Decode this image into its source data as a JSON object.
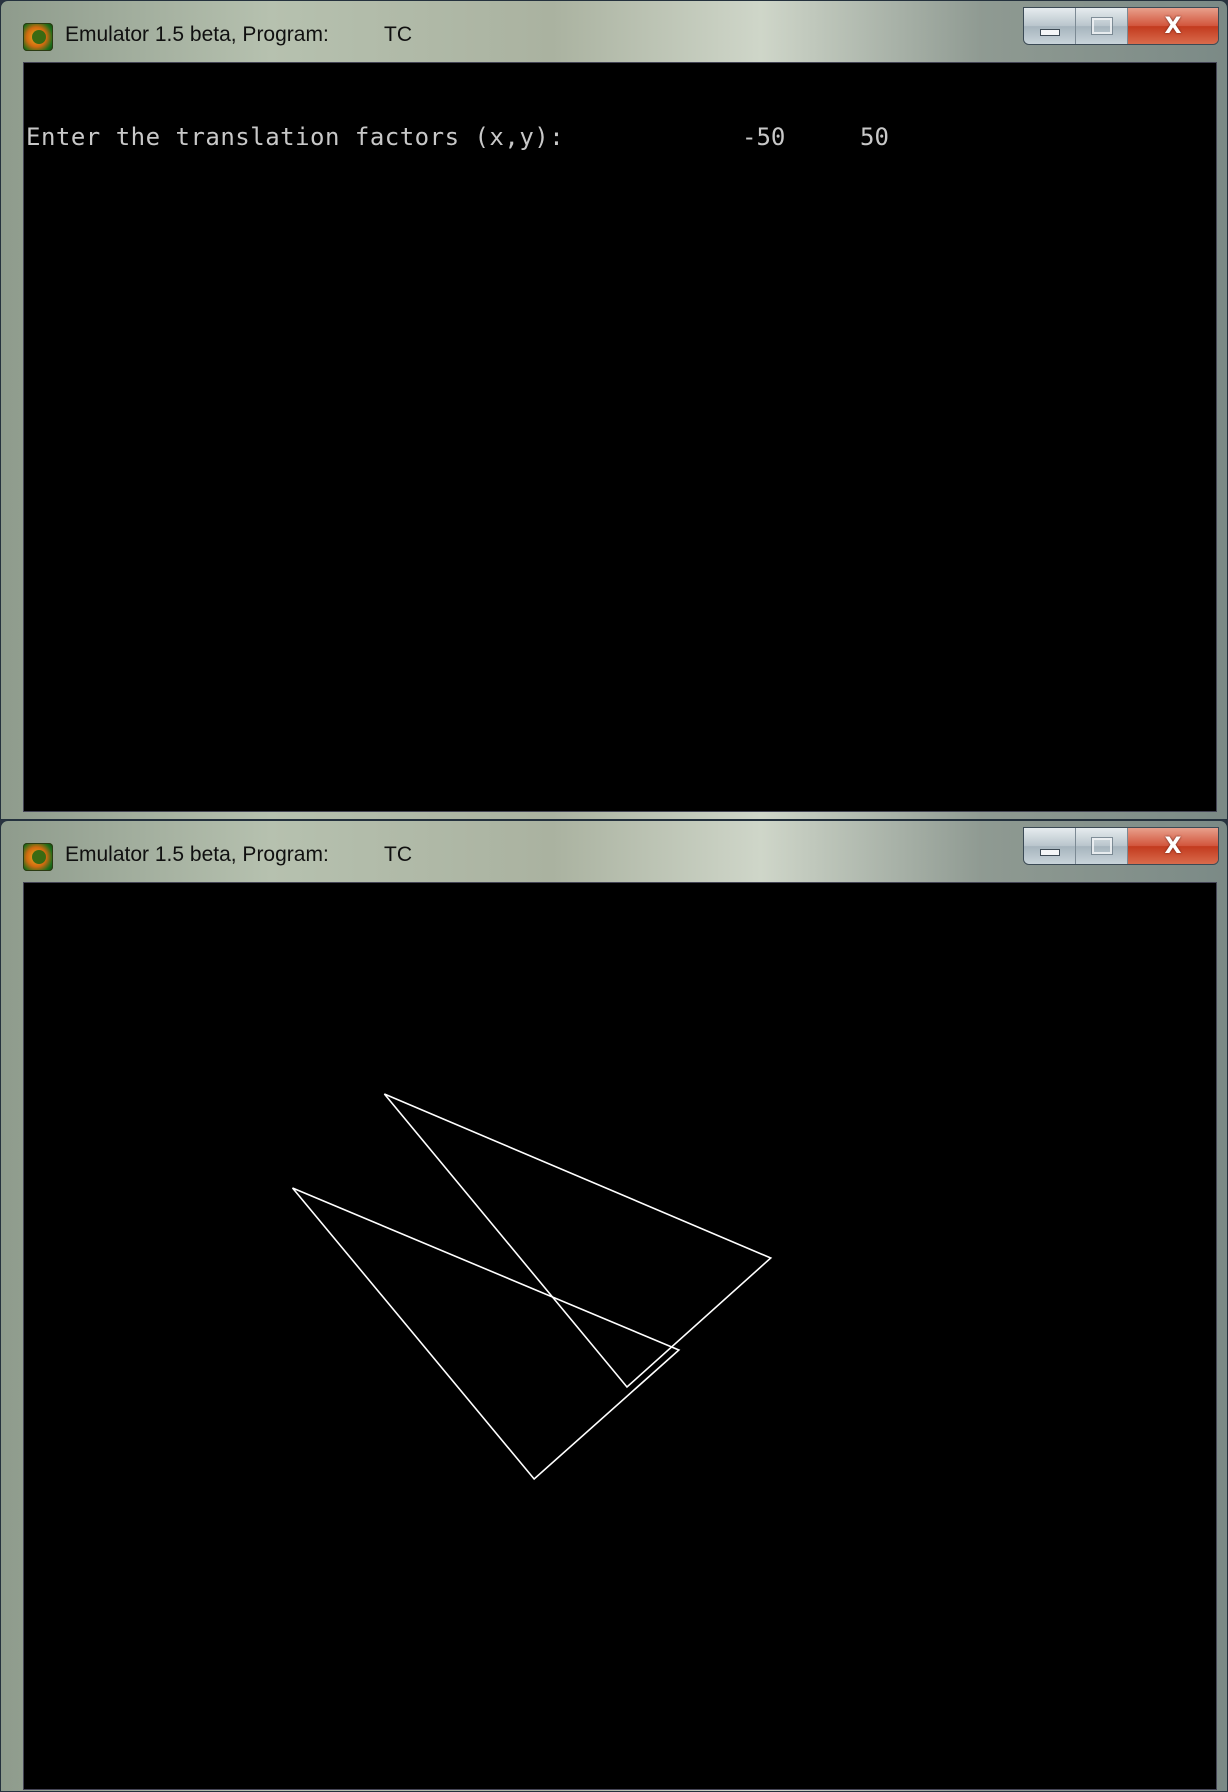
{
  "windows": [
    {
      "title": "Emulator 1.5 beta, Program:",
      "program": "TC",
      "controls": {
        "minimize": "minimize",
        "maximize": "maximize",
        "close": "X"
      },
      "console": {
        "prompt": "Enter the translation factors (x,y):",
        "tx": "-50",
        "ty": "50"
      }
    },
    {
      "title": "Emulator 1.5 beta, Program:",
      "program": "TC",
      "controls": {
        "minimize": "minimize",
        "maximize": "maximize",
        "close": "X"
      },
      "graphics": {
        "shapes": [
          "original-triangle",
          "translated-triangle"
        ],
        "color": "#ffffff"
      }
    }
  ],
  "colors": {
    "console_bg": "#000000",
    "console_text": "#c8c8c8",
    "close_button": "#c23a1e"
  }
}
